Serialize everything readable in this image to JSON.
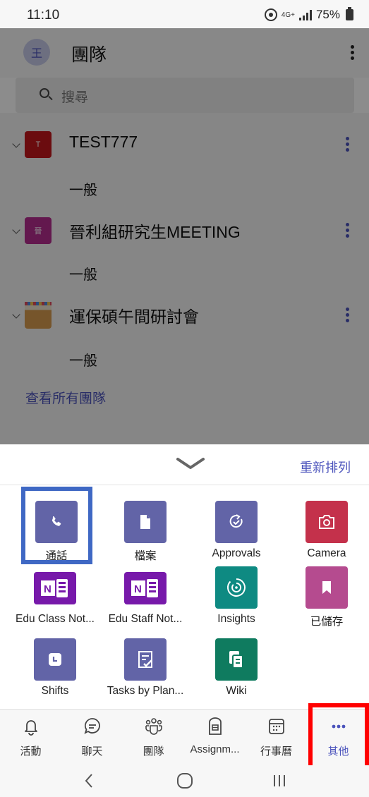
{
  "status_bar": {
    "time": "11:10",
    "network": "4G+",
    "battery": "75%"
  },
  "header": {
    "avatar_initial": "王",
    "title": "團隊"
  },
  "search": {
    "placeholder": "搜尋"
  },
  "teams": [
    {
      "name": "TEST777",
      "avatar_text": "T",
      "channel": "一般"
    },
    {
      "name": "晉利組研究生MEETING",
      "avatar_text": "晉",
      "channel": "一般"
    },
    {
      "name": "運保碩午間研討會",
      "avatar_text": "",
      "channel": "一般"
    }
  ],
  "see_all_teams": "查看所有團隊",
  "sheet": {
    "reorder_label": "重新排列",
    "apps": [
      {
        "label": "通話",
        "icon": "phone-icon",
        "color": "#6264a7"
      },
      {
        "label": "檔案",
        "icon": "file-icon",
        "color": "#6264a7"
      },
      {
        "label": "Approvals",
        "icon": "approvals-icon",
        "color": "#6264a7"
      },
      {
        "label": "Camera",
        "icon": "camera-icon",
        "color": "#c4314b"
      },
      {
        "label": "Edu Class Not...",
        "icon": "onenote-icon",
        "color": "#7719aa"
      },
      {
        "label": "Edu Staff Not...",
        "icon": "onenote-icon",
        "color": "#7719aa"
      },
      {
        "label": "Insights",
        "icon": "insights-icon",
        "color": "#0e8a82"
      },
      {
        "label": "已儲存",
        "icon": "bookmark-icon",
        "color": "#b54b8f"
      },
      {
        "label": "Shifts",
        "icon": "clock-icon",
        "color": "#6264a7"
      },
      {
        "label": "Tasks by Plan...",
        "icon": "tasks-icon",
        "color": "#6264a7"
      },
      {
        "label": "Wiki",
        "icon": "wiki-icon",
        "color": "#0f7b5f"
      }
    ]
  },
  "bottom_nav": [
    {
      "label": "活動",
      "icon": "bell-icon"
    },
    {
      "label": "聊天",
      "icon": "chat-icon"
    },
    {
      "label": "團隊",
      "icon": "teams-icon"
    },
    {
      "label": "Assignm...",
      "icon": "assignments-icon"
    },
    {
      "label": "行事曆",
      "icon": "calendar-icon"
    },
    {
      "label": "其他",
      "icon": "more-icon",
      "active": true
    }
  ],
  "colors": {
    "accent": "#4b53bc",
    "highlight_blue": "#3f68c4",
    "highlight_red": "#ff0000"
  }
}
